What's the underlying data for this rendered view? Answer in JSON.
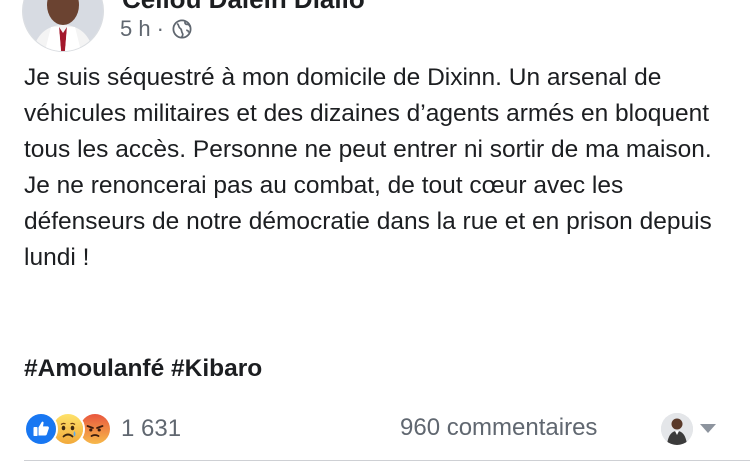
{
  "post": {
    "author": "Cellou Dalein Diallo",
    "time": "5 h",
    "separator": "·",
    "privacy_icon": "globe-icon",
    "paragraphs": [
      "Je suis séquestré à mon domicile de Dixinn. Un arsenal de véhicules militaires et des dizaines d’agents armés en bloquent tous les accès. Personne ne peut entrer ni sortir de ma maison.",
      "Je ne renoncerai pas au combat, de tout cœur avec les défenseurs de notre démocratie dans la rue et en prison depuis lundi !"
    ],
    "hashtags": [
      "#Amoulanfé",
      "#Kibaro"
    ]
  },
  "footer": {
    "reaction_icons": [
      "like-icon",
      "sad-icon",
      "angry-icon"
    ],
    "reaction_count": "1 631",
    "comments": "960 commentaires"
  },
  "colors": {
    "text": "#1c1e21",
    "secondary_text": "#606770",
    "like_blue": "#1877f2",
    "sad_yellow": "#f7c744",
    "angry_red": "#e9573e",
    "divider": "#ced0d4"
  }
}
